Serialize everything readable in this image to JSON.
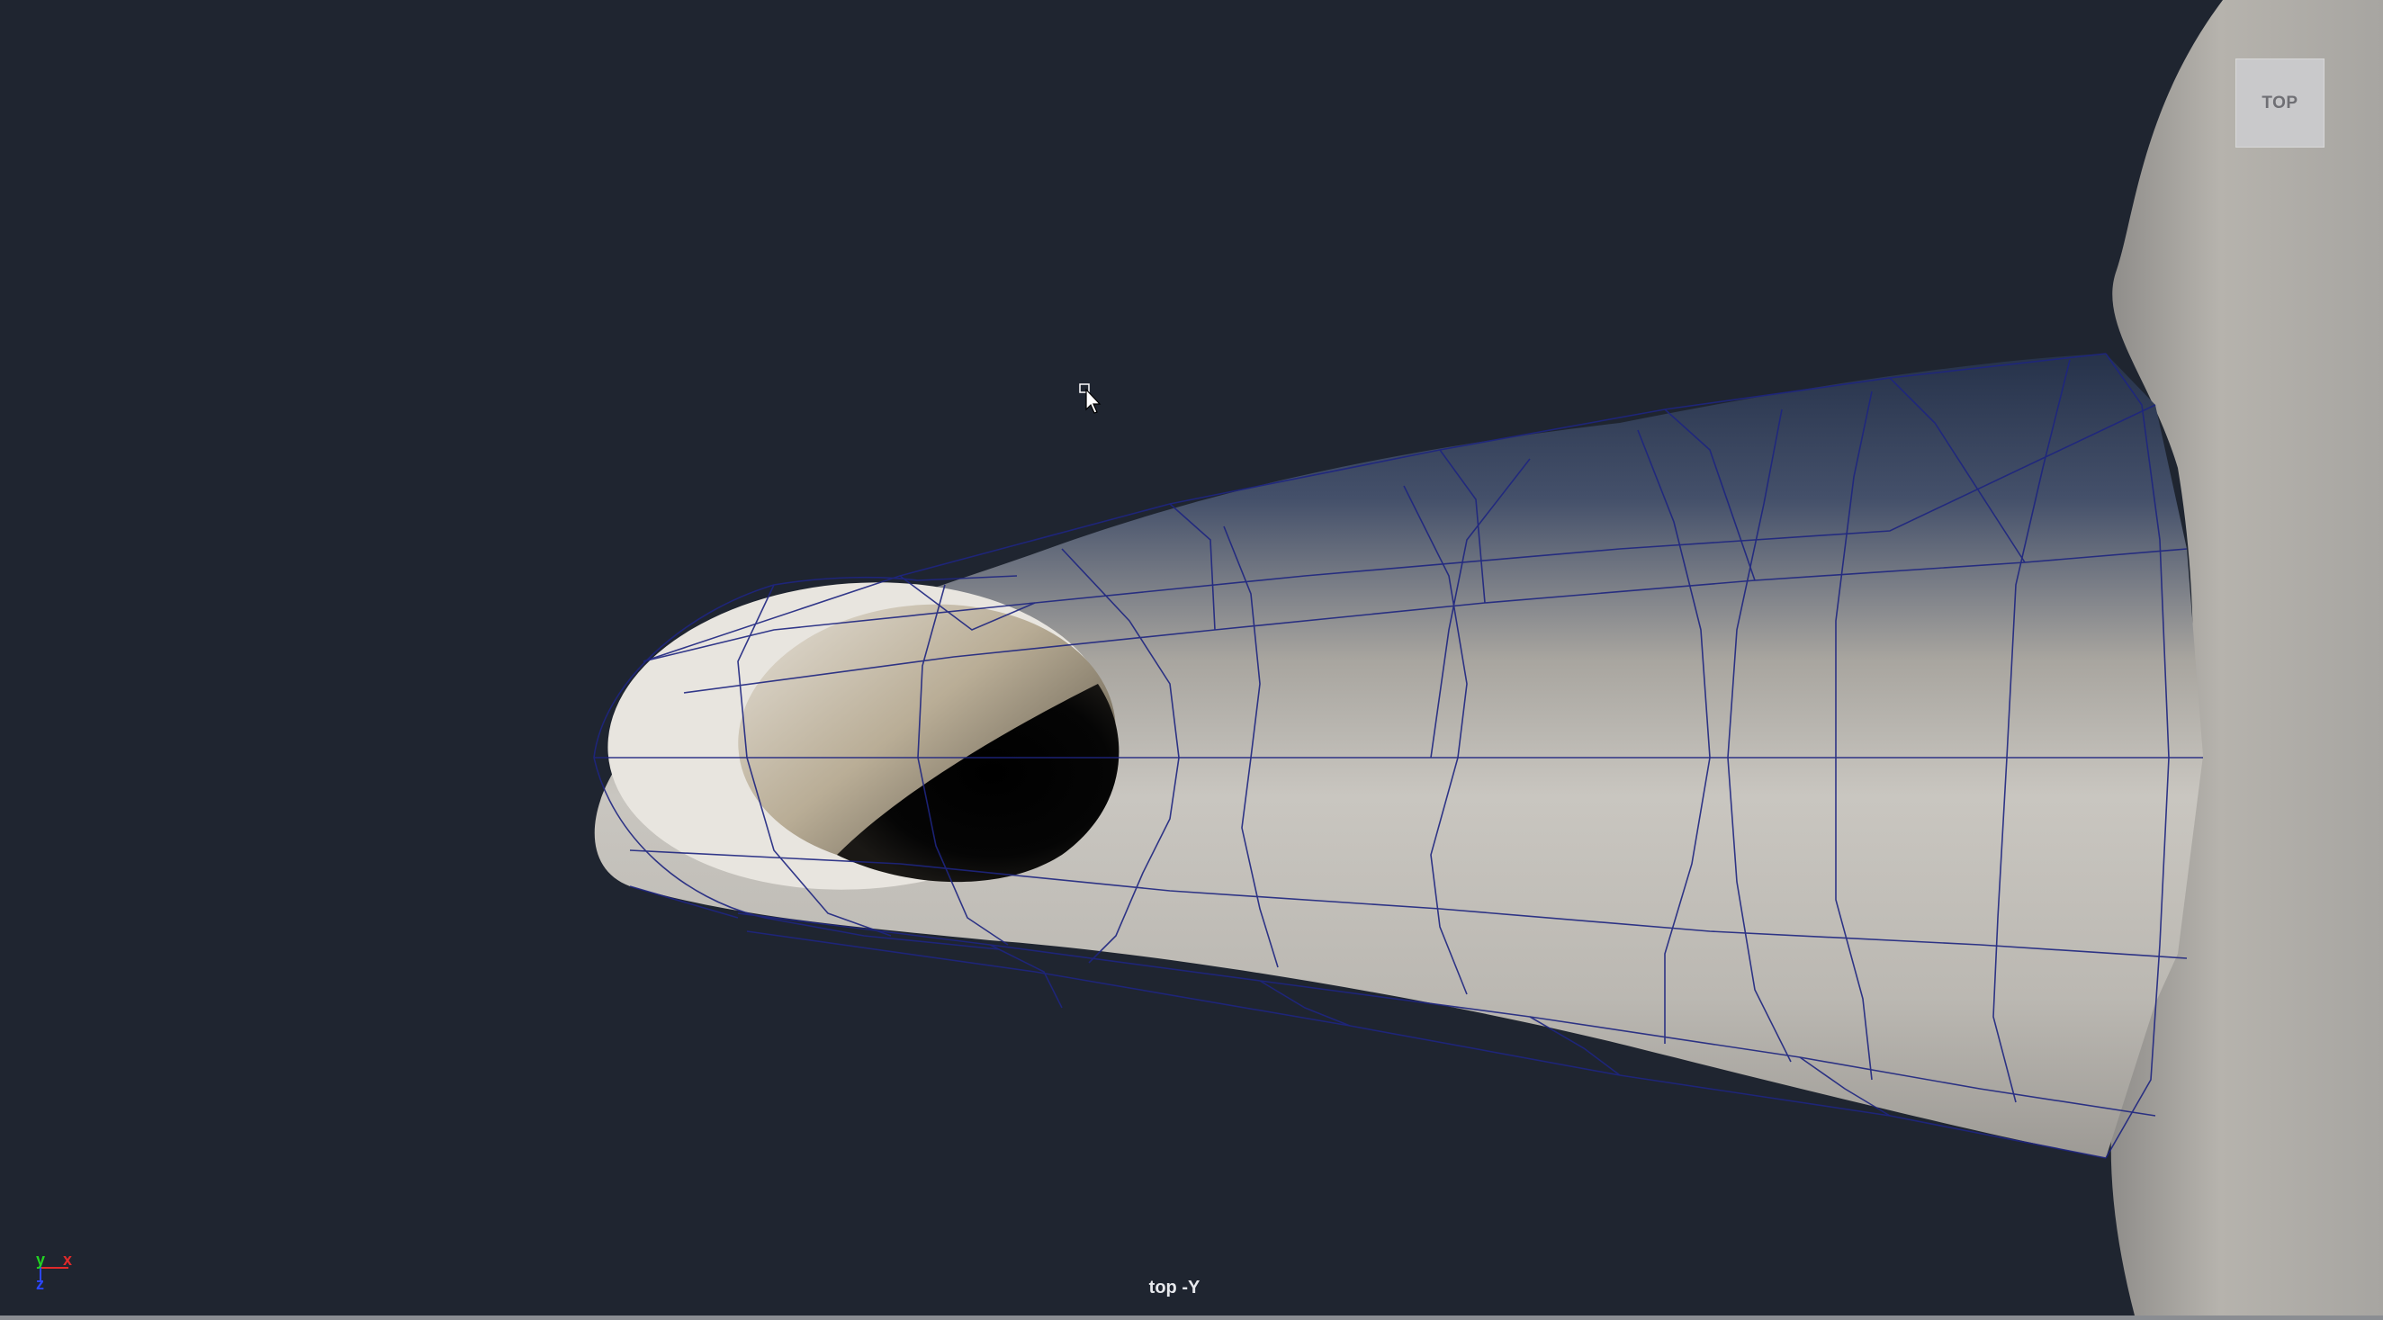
{
  "viewport": {
    "view_cube_label": "TOP",
    "camera_label": "top -Y",
    "axes": {
      "y": "y",
      "x": "x",
      "z": "z"
    }
  },
  "colors": {
    "background": "#1f2530",
    "mesh_wire": "#1e2580",
    "surface": "#b9b5ae",
    "axis_x": "#e02a2a",
    "axis_y": "#22d422",
    "axis_z": "#2b46ff"
  },
  "icons": {
    "cursor": "arrow-cursor-icon"
  }
}
